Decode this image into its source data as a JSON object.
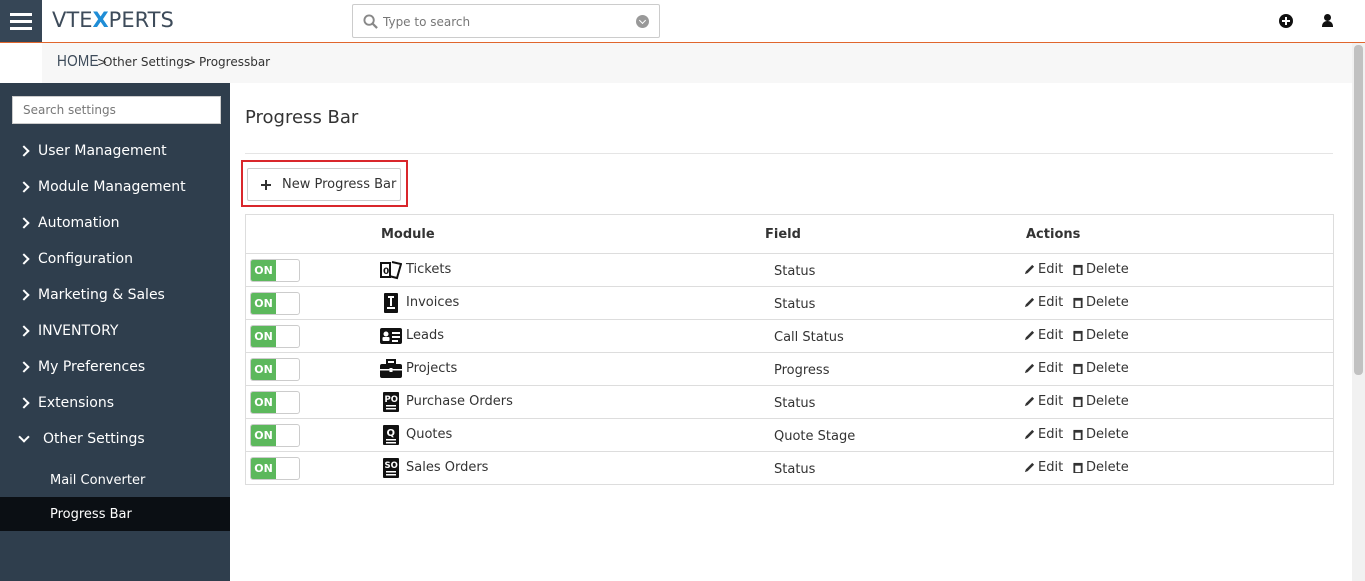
{
  "header": {
    "logo_prefix": "VTE",
    "logo_x": "X",
    "logo_suffix": "PERTS",
    "search_placeholder": "Type to search",
    "icons": [
      "menu-icon",
      "search-icon",
      "dropdown-icon",
      "plus-circle-icon",
      "user-icon"
    ]
  },
  "breadcrumb": {
    "home": "HOME",
    "sep1": ">",
    "item1": "Other Settings",
    "sep2": ">",
    "item2": "Progressbar"
  },
  "sidebar": {
    "search_placeholder": "Search settings",
    "items": [
      {
        "label": "User Management"
      },
      {
        "label": "Module Management"
      },
      {
        "label": "Automation"
      },
      {
        "label": "Configuration"
      },
      {
        "label": "Marketing & Sales"
      },
      {
        "label": "INVENTORY"
      },
      {
        "label": "My Preferences"
      },
      {
        "label": "Extensions"
      },
      {
        "label": "Other Settings"
      }
    ],
    "subitems": [
      {
        "label": "Mail Converter"
      },
      {
        "label": "Progress Bar"
      }
    ]
  },
  "main": {
    "title": "Progress Bar",
    "new_button": "New Progress Bar",
    "columns": {
      "module": "Module",
      "field": "Field",
      "actions": "Actions"
    },
    "toggle_label": "ON",
    "edit_label": "Edit",
    "delete_label": "Delete",
    "rows": [
      {
        "module": "Tickets",
        "field": "Status",
        "icon": "tickets-icon"
      },
      {
        "module": "Invoices",
        "field": "Status",
        "icon": "invoice-icon"
      },
      {
        "module": "Leads",
        "field": "Call Status",
        "icon": "leads-icon"
      },
      {
        "module": "Projects",
        "field": "Progress",
        "icon": "briefcase-icon"
      },
      {
        "module": "Purchase Orders",
        "field": "Status",
        "icon": "purchase-order-icon"
      },
      {
        "module": "Quotes",
        "field": "Quote Stage",
        "icon": "quote-icon"
      },
      {
        "module": "Sales Orders",
        "field": "Status",
        "icon": "sales-order-icon"
      }
    ]
  },
  "colors": {
    "sidebar_bg": "#2f3e4d",
    "active_bg": "#0b0f14",
    "toggle_on": "#5cb85c",
    "header_rule": "#e0662d",
    "highlight": "#d9262b"
  }
}
